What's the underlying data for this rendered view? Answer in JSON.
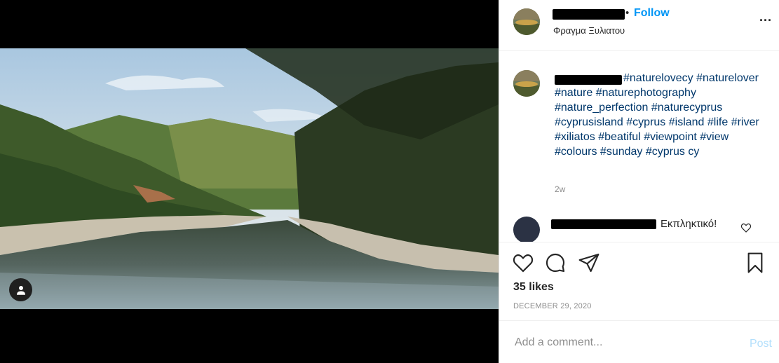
{
  "post": {
    "header": {
      "follow_separator": "•",
      "follow_label": "Follow",
      "location": "Φραγμα Ξυλιατου",
      "more_label": "..."
    },
    "caption": {
      "text": "#naturelovecy #naturelover #nature #naturephotography #nature_perfection #naturecyprus #cyprusisland #cyprus #island #life #river #xiliatos #beatiful #viewpoint #view #colours #sunday #cyprus cy",
      "age": "2w"
    },
    "comment": {
      "text": "Εκπληκτικό!"
    },
    "stats": {
      "likes": "35 likes",
      "date": "DECEMBER 29, 2020"
    },
    "add_comment": {
      "placeholder": "Add a comment...",
      "post_label": "Post"
    }
  },
  "icons": {
    "like": "heart-icon",
    "comment": "comment-bubble-icon",
    "share": "paper-plane-icon",
    "save": "bookmark-icon",
    "tag": "user-tag-icon"
  },
  "colors": {
    "link": "#00376b",
    "follow": "#0095f6",
    "post_disabled": "#b2dffc",
    "muted": "#8e8e8e"
  }
}
